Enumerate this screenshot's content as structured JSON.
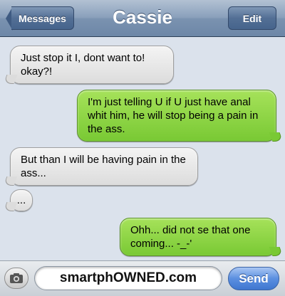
{
  "header": {
    "back_label": "Messages",
    "title": "Cassie",
    "edit_label": "Edit"
  },
  "messages": [
    {
      "side": "received",
      "text": "Just stop it I, dont want to! okay?!"
    },
    {
      "side": "sent",
      "text": "I'm just telling U if U just have anal whit him, he will stop being a pain in the ass."
    },
    {
      "side": "received",
      "text": "But than I will be having pain in the ass..."
    },
    {
      "side": "received",
      "text": "..."
    },
    {
      "side": "sent",
      "text": "Ohh... did not se that one coming... -_-'"
    }
  ],
  "composer": {
    "camera_icon": "camera-icon",
    "input_value": "smartphOWNED.com",
    "send_label": "Send"
  },
  "colors": {
    "received_bubble": "#e4e4e4",
    "sent_bubble": "#8fd64a",
    "nav_bar": "#8aa0bb",
    "send_button": "#4f86d8"
  }
}
